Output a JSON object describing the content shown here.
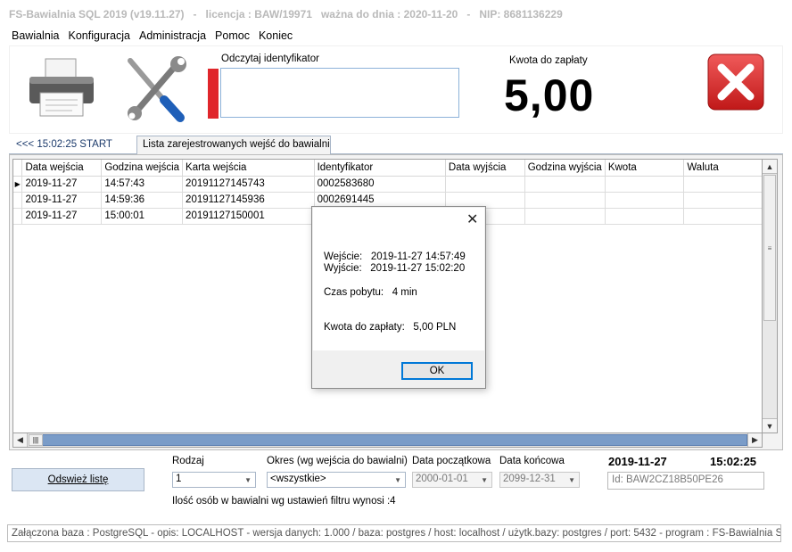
{
  "window": {
    "title": "FS-Bawialnia SQL 2019 (v19.11.27)   -   licencja : BAW/19971   ważna do dnia : 2020-11-20   -   NIP: 8681136229"
  },
  "menu": [
    "Bawialnia",
    "Konfiguracja",
    "Administracja",
    "Pomoc",
    "Koniec"
  ],
  "top": {
    "identifier_label": "Odczytaj identyfikator",
    "identifier_value": "",
    "amount_label": "Kwota do zapłaty",
    "amount_value": "5,00",
    "icons": [
      "printer-icon",
      "tools-icon",
      "close-red-icon"
    ],
    "accent_red": "#e0262b"
  },
  "tabs": {
    "start": "<<<  15:02:25  START",
    "list": "Lista zarejestrowanych wejść do bawialni"
  },
  "grid": {
    "columns": [
      "Data wejścia",
      "Godzina wejścia",
      "Karta wejścia",
      "Identyfikator",
      "Data wyjścia",
      "Godzina wyjścia",
      "Kwota",
      "Waluta"
    ],
    "rows": [
      [
        "2019-11-27",
        "14:57:43",
        "20191127145743",
        "0002583680",
        "",
        "",
        "",
        ""
      ],
      [
        "2019-11-27",
        "14:59:36",
        "20191127145936",
        "0002691445",
        "",
        "",
        "",
        ""
      ],
      [
        "2019-11-27",
        "15:00:01",
        "20191127150001",
        "",
        "",
        "",
        "",
        ""
      ]
    ]
  },
  "filters": {
    "refresh_label": "Odswież listę",
    "rodzaj_label": "Rodzaj",
    "rodzaj_value": "1",
    "okres_label": "Okres (wg wejścia do bawialni)",
    "okres_value": "<wszystkie>",
    "date_from_label": "Data początkowa",
    "date_from_value": "2000-01-01",
    "date_to_label": "Data końcowa",
    "date_to_value": "2099-12-31",
    "current_date": "2019-11-27",
    "current_time": "15:02:25",
    "id_value": "Id: BAW2CZ18B50PE26",
    "count_text": "Ilość osób w bawialni wg ustawień filtru wynosi :4"
  },
  "status": "Załączona baza : PostgreSQL - opis: LOCALHOST - wersja danych: 1.000  / baza: postgres / host: localhost / użytk.bazy: postgres /  port:  5432  - program :  FS-Bawialnia SQL edy",
  "dialog": {
    "entry_line": "Wejście:   2019-11-27 14:57:49",
    "exit_line": "Wyjście:   2019-11-27 15:02:20",
    "stay_line": "Czas pobytu:   4 min",
    "amount_line": "Kwota do zapłaty:   5,00 PLN",
    "ok_label": "OK"
  }
}
